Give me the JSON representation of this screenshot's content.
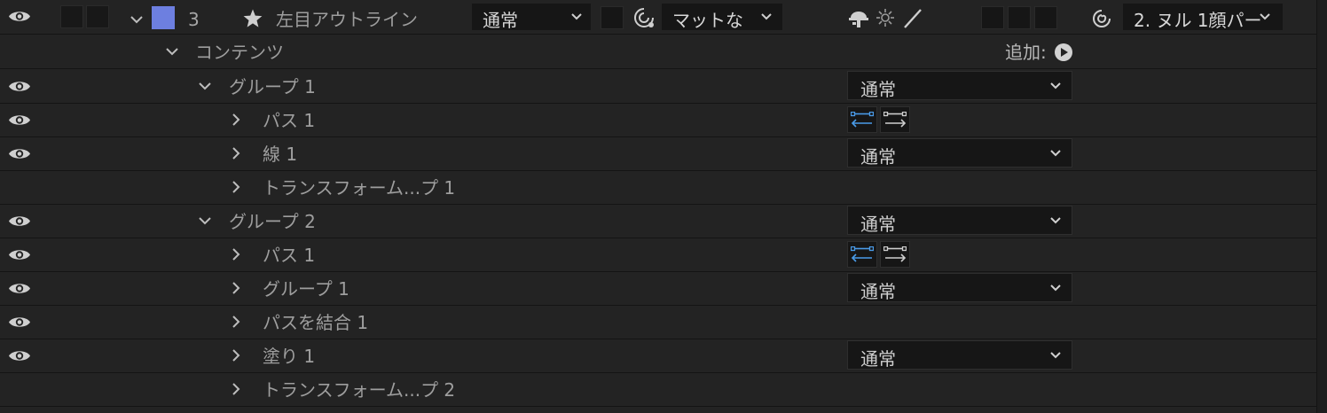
{
  "layer": {
    "number": "3",
    "name": "左目アウトライン",
    "label_color": "#6d7fe0",
    "blend_mode": "通常",
    "track_matte": "マットな",
    "parent": "2. ヌル 1顔パー"
  },
  "contents": {
    "label": "コンテンツ",
    "add_label": "追加:"
  },
  "rows": [
    {
      "label": "グループ 1",
      "mode": "通常"
    },
    {
      "label": "パス 1"
    },
    {
      "label": "線 1",
      "mode": "通常"
    },
    {
      "label": "トランスフォーム...プ 1"
    },
    {
      "label": "グループ 2",
      "mode": "通常"
    },
    {
      "label": "パス 1"
    },
    {
      "label": "グループ 1",
      "mode": "通常"
    },
    {
      "label": "パスを結合 1"
    },
    {
      "label": "塗り 1",
      "mode": "通常"
    },
    {
      "label": "トランスフォーム...プ 2"
    }
  ],
  "colors": {
    "accent_blue": "#4a9be8",
    "background": "#232323"
  }
}
